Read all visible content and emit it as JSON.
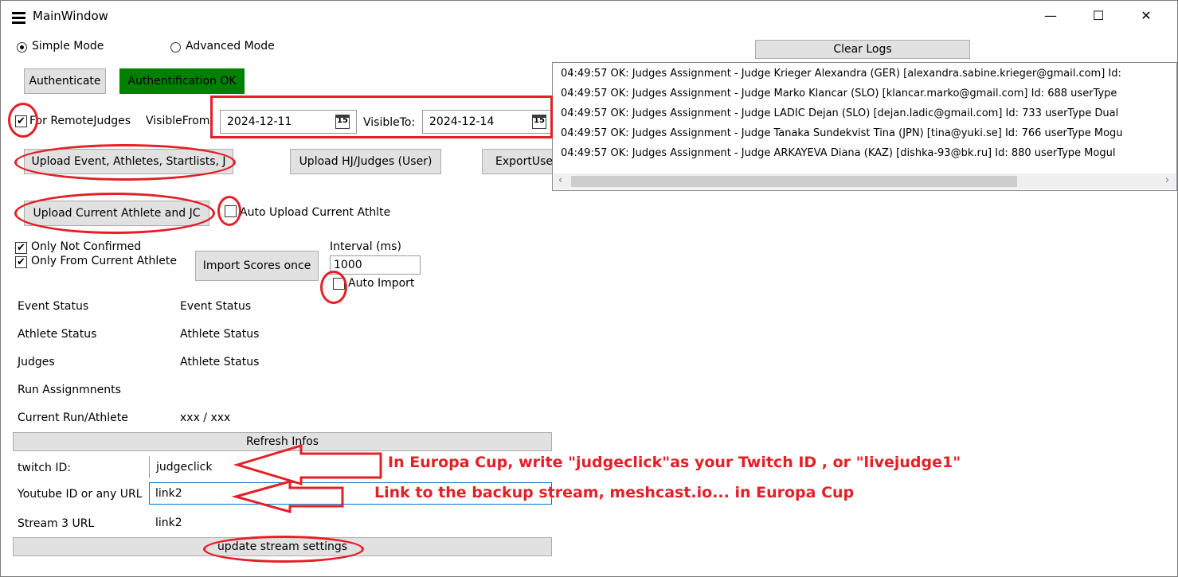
{
  "window": {
    "title": "MainWindow",
    "minimize": "—",
    "maximize": "☐",
    "close": "✕"
  },
  "modes": {
    "simple": "Simple Mode",
    "advanced": "Advanced Mode",
    "selected": "simple"
  },
  "auth": {
    "button": "Authenticate",
    "status": "Authentification OK",
    "status_color": "#008000"
  },
  "remote": {
    "checkbox_label": "For RemoteJudges",
    "checked": true,
    "visible_from_label": "VisibleFrom:",
    "visible_from": "2024-12-11",
    "visible_to_label": "VisibleTo:",
    "visible_to": "2024-12-14",
    "cal_day": "15"
  },
  "uploads": {
    "event": "Upload Event, Athletes, Startlists, J",
    "hj": "Upload HJ/Judges (User)",
    "export": "ExportUser",
    "current": "Upload Current Athlete and JC",
    "auto_upload_label": "Auto Upload Current Athlte"
  },
  "import": {
    "only_not_confirmed": "Only Not Confirmed",
    "only_current": "Only From Current Athlete",
    "button": "Import Scores once",
    "interval_label": "Interval (ms)",
    "interval_value": "1000",
    "auto_import": "Auto Import"
  },
  "status": [
    {
      "label": "Event Status",
      "value": "Event Status"
    },
    {
      "label": "Athlete Status",
      "value": "Athlete Status"
    },
    {
      "label": "Judges",
      "value": "Athlete Status"
    },
    {
      "label": "Run Assignmnents",
      "value": ""
    },
    {
      "label": "Current Run/Athlete",
      "value": "xxx / xxx"
    }
  ],
  "refresh": "Refresh Infos",
  "streams": [
    {
      "label": "twitch ID:",
      "value": "judgeclick"
    },
    {
      "label": "Youtube ID or any URL",
      "value": "link2"
    },
    {
      "label": "Stream 3 URL",
      "value": "link2"
    }
  ],
  "update_stream": "update stream settings",
  "logs": {
    "clear": "Clear Logs",
    "lines": [
      "04:49:57 OK: Judges Assignment - Judge Krieger Alexandra  (GER) [alexandra.sabine.krieger@gmail.com] Id:",
      "04:49:57 OK: Judges Assignment - Judge Marko Klancar (SLO) [klancar.marko@gmail.com] Id: 688 userType",
      "04:49:57 OK: Judges Assignment - Judge LADIC Dejan (SLO) [dejan.ladic@gmail.com] Id: 733 userType Dual",
      "04:49:57 OK: Judges Assignment - Judge Tanaka Sundekvist Tina (JPN) [tina@yuki.se] Id: 766 userType Mogu",
      "04:49:57 OK: Judges Assignment - Judge ARKAYEVA Diana (KAZ) [dishka-93@bk.ru] Id: 880 userType Mogul"
    ]
  },
  "annotations": {
    "twitch_note": "In Europa Cup, write \"judgeclick\"as your Twitch ID , or \"livejudge1\"",
    "backup_note": "Link to the backup stream, meshcast.io... in Europa Cup",
    "color": "#e41f26"
  }
}
